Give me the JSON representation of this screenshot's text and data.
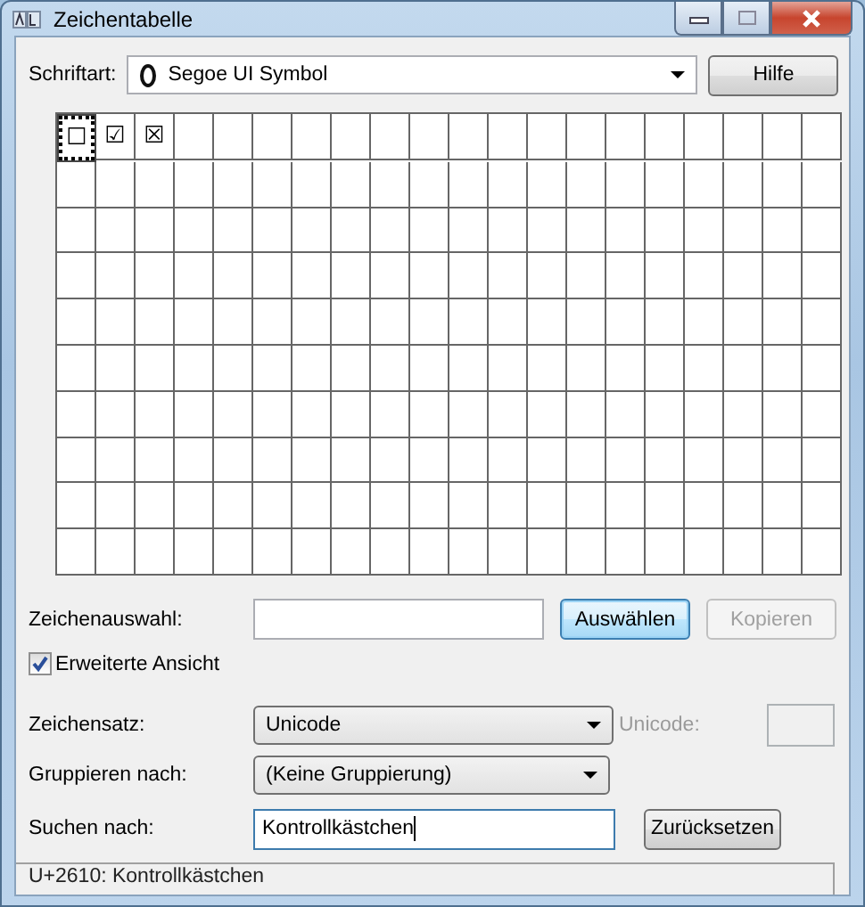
{
  "window": {
    "title": "Zeichentabelle"
  },
  "font": {
    "label": "Schriftart:",
    "value": "Segoe UI Symbol"
  },
  "help_button": "Hilfe",
  "cells": [
    {
      "char": "☐",
      "selected": true
    },
    {
      "char": "☑",
      "selected": false
    },
    {
      "char": "☒",
      "selected": false
    }
  ],
  "selection": {
    "label": "Zeichenauswahl:"
  },
  "buttons": [
    {
      "label": "Auswählen",
      "default": true,
      "disabled": false
    },
    {
      "label": "Kopieren",
      "default": false,
      "disabled": true
    }
  ],
  "advanced": {
    "label": "Erweiterte Ansicht",
    "checked": true
  },
  "charset": {
    "label": "Zeichensatz:",
    "value": "Unicode"
  },
  "unicode": {
    "label": "Unicode:",
    "disabled": true
  },
  "group": {
    "label": "Gruppieren nach:",
    "value": "(Keine Gruppierung)"
  },
  "search": {
    "label": "Suchen nach:",
    "value": "Kontrollkästchen"
  },
  "reset_button": "Zurücksetzen",
  "status_bar": "U+2610: Kontrollkästchen"
}
